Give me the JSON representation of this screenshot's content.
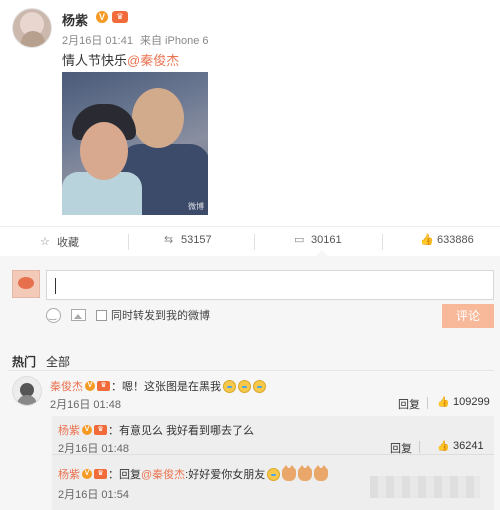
{
  "post": {
    "author": "杨紫",
    "badge_v": "V",
    "badge_member": "♛",
    "time": "2月16日 01:41",
    "source": "来自 iPhone 6",
    "text_prefix": "情人节快乐",
    "mention": "@秦俊杰",
    "photo_watermark": "微博"
  },
  "actions": {
    "favorite": "收藏",
    "repost_count": "53157",
    "comment_count": "30161",
    "like_count": "633886"
  },
  "composer": {
    "placeholder": "",
    "repost_checkbox_label": "同时转发到我的微博",
    "submit_label": "评论"
  },
  "comment_tabs": {
    "hot": "热门",
    "all": "全部"
  },
  "comments": [
    {
      "author": "秦俊杰",
      "text": "：嗯！这张图是在黑我",
      "time": "2月16日 01:48",
      "reply_label": "回复",
      "likes": "109299"
    }
  ],
  "replies": [
    {
      "author": "杨紫",
      "text": "：有意见么 我好看到哪去了么",
      "time": "2月16日 01:48",
      "reply_label": "回复",
      "likes": "36241"
    },
    {
      "author": "杨紫",
      "text_prefix": "：回复",
      "mention": "@秦俊杰",
      "text_suffix": ":好好爱你女朋友",
      "time": "2月16日 01:54"
    }
  ],
  "colors": {
    "accent": "#eb7350",
    "badge_v": "#f59a23",
    "badge_member": "#f26b3a",
    "submit_disabled": "#f8b99a"
  },
  "icons": {
    "favorite": "star-icon",
    "repost": "repost-icon",
    "comment": "comment-icon",
    "like": "thumbs-up-icon",
    "emoji": "smiley-icon",
    "image": "image-icon"
  }
}
